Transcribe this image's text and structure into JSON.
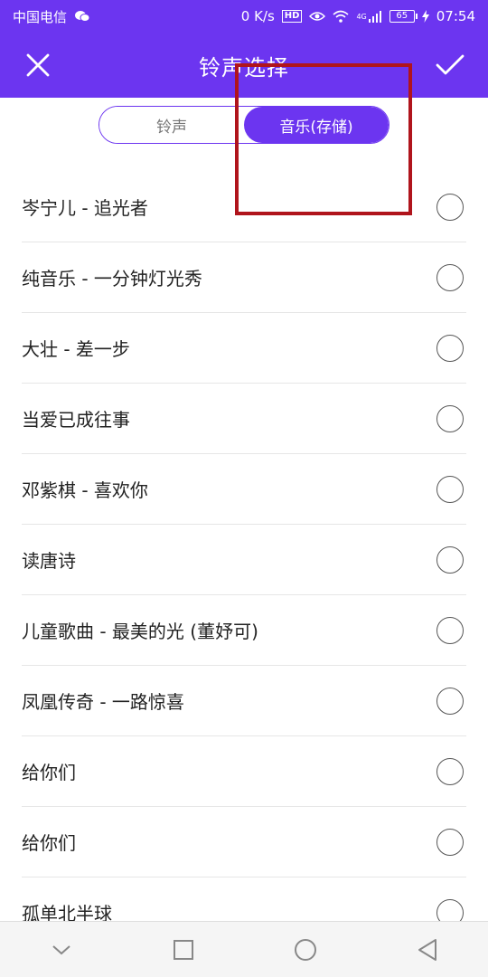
{
  "status_bar": {
    "carrier": "中国电信",
    "speed": "0 K/s",
    "hd_badge": "HD",
    "network": "4G",
    "battery": "65",
    "time": "07:54"
  },
  "header": {
    "title": "铃声选择"
  },
  "tabs": [
    {
      "label": "铃声",
      "active": false
    },
    {
      "label": "音乐(存储)",
      "active": true
    }
  ],
  "songs": [
    "岑宁儿 - 追光者",
    "纯音乐 - 一分钟灯光秀",
    "大壮 - 差一步",
    "当爱已成往事",
    "邓紫棋 - 喜欢你",
    "读唐诗",
    "儿童歌曲 - 最美的光 (董妤可)",
    "凤凰传奇 - 一路惊喜",
    "给你们",
    "给你们",
    "孤单北半球"
  ],
  "colors": {
    "accent": "#6c35f0",
    "highlight": "#b0141c"
  },
  "icons": {
    "close": "close-icon",
    "confirm": "check-icon",
    "nav_back": "triangle-back-icon",
    "nav_home": "circle-home-icon",
    "nav_recent": "square-recent-icon",
    "nav_hide": "chevron-down-icon"
  }
}
